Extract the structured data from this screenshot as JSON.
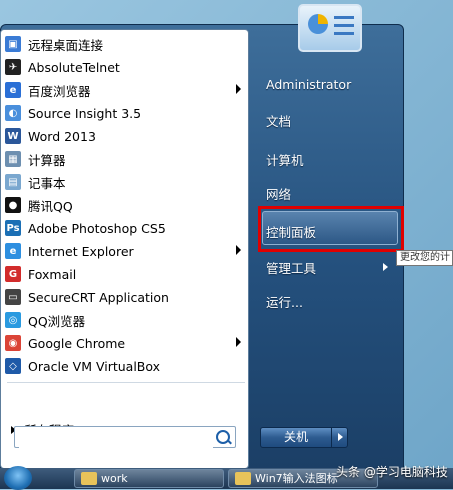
{
  "programs": [
    {
      "label": "远程桌面连接",
      "icon": "remote-desktop-icon",
      "color": "#3a7bd5",
      "glyph": "▣",
      "arrow": false
    },
    {
      "label": "AbsoluteTelnet",
      "icon": "telnet-icon",
      "color": "#222222",
      "glyph": "✈",
      "arrow": false
    },
    {
      "label": "百度浏览器",
      "icon": "baidu-browser-icon",
      "color": "#2a6fd6",
      "glyph": "e",
      "arrow": true
    },
    {
      "label": "Source Insight 3.5",
      "icon": "source-insight-icon",
      "color": "#4a8fdc",
      "glyph": "◐",
      "arrow": false
    },
    {
      "label": "Word 2013",
      "icon": "word-icon",
      "color": "#2b579a",
      "glyph": "W",
      "arrow": false
    },
    {
      "label": "计算器",
      "icon": "calculator-icon",
      "color": "#6d8fb0",
      "glyph": "▦",
      "arrow": false
    },
    {
      "label": "记事本",
      "icon": "notepad-icon",
      "color": "#7aa7cf",
      "glyph": "▤",
      "arrow": false
    },
    {
      "label": "腾讯QQ",
      "icon": "qq-icon",
      "color": "#111111",
      "glyph": "●",
      "arrow": false
    },
    {
      "label": "Adobe Photoshop CS5",
      "icon": "photoshop-icon",
      "color": "#1b6fb5",
      "glyph": "Ps",
      "arrow": false
    },
    {
      "label": "Internet Explorer",
      "icon": "ie-icon",
      "color": "#2d8fe0",
      "glyph": "e",
      "arrow": true
    },
    {
      "label": "Foxmail",
      "icon": "foxmail-icon",
      "color": "#d22c2c",
      "glyph": "G",
      "arrow": false
    },
    {
      "label": "SecureCRT Application",
      "icon": "securecrt-icon",
      "color": "#444444",
      "glyph": "▭",
      "arrow": false
    },
    {
      "label": "QQ浏览器",
      "icon": "qq-browser-icon",
      "color": "#2a9ae0",
      "glyph": "◎",
      "arrow": false
    },
    {
      "label": "Google Chrome",
      "icon": "chrome-icon",
      "color": "#db4437",
      "glyph": "◉",
      "arrow": true
    },
    {
      "label": "Oracle VM VirtualBox",
      "icon": "virtualbox-icon",
      "color": "#1f5aa8",
      "glyph": "◇",
      "arrow": false
    }
  ],
  "all_programs": "所有程序",
  "search": {
    "placeholder": ""
  },
  "right_items": [
    "Administrator",
    "文档",
    "计算机",
    "网络",
    "控制面板",
    "管理工具",
    "运行..."
  ],
  "shutdown_label": "关机",
  "tooltip": "更改您的计",
  "taskbar": [
    "work",
    "Win7输入法图标"
  ],
  "watermark": "头条 @学习电脑科技"
}
